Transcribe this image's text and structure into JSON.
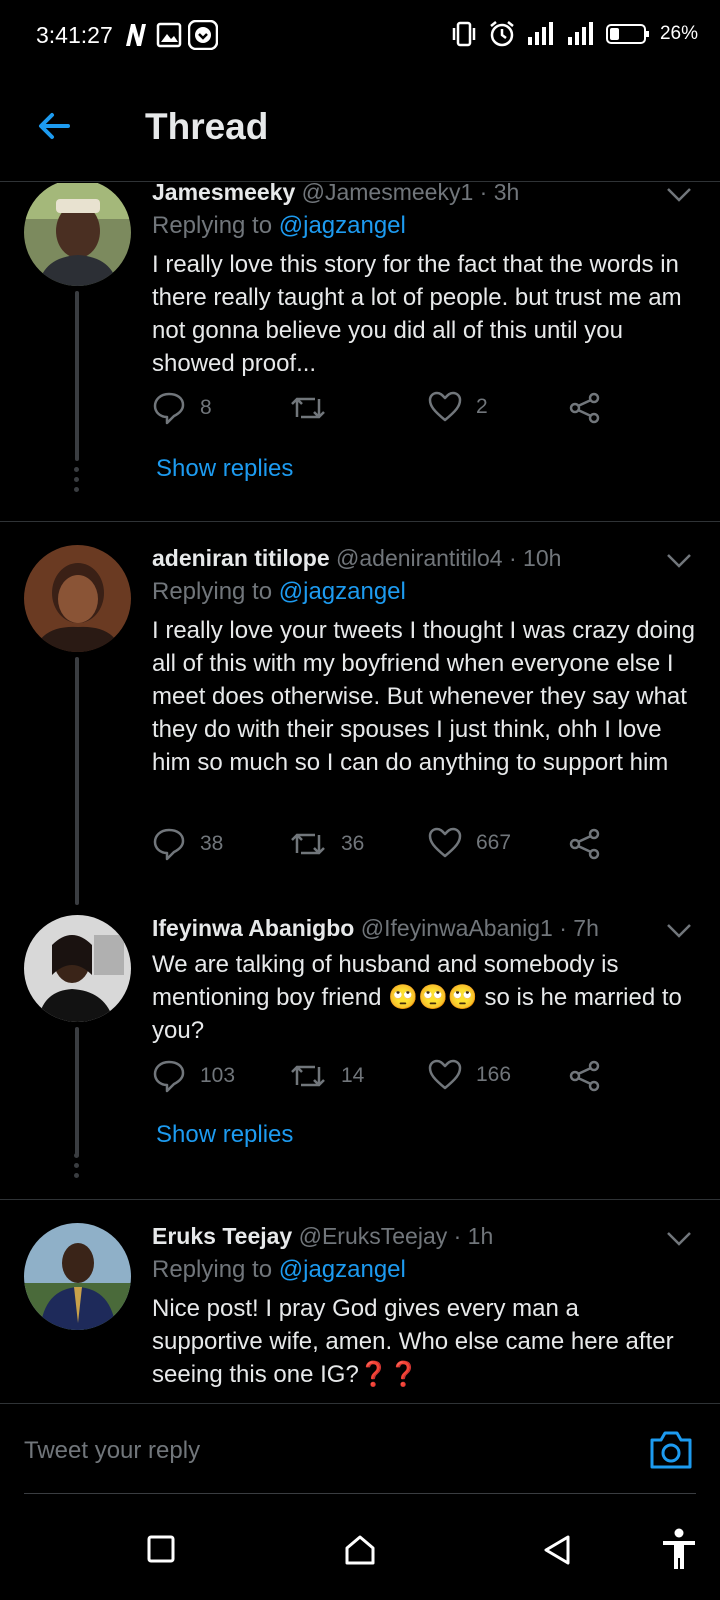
{
  "status_bar": {
    "time": "3:41:27",
    "battery": "26%",
    "icons": [
      "netflix-icon",
      "gallery-icon",
      "download-icon",
      "vibrate-icon",
      "alarm-icon",
      "signal-icon",
      "signal-icon",
      "battery-icon"
    ]
  },
  "header": {
    "title": "Thread",
    "back_icon": "arrow-left-icon"
  },
  "colors": {
    "accent": "#1d9bf0",
    "background": "#000000",
    "muted": "#71767b",
    "text": "#e7e9ea"
  },
  "tweets": [
    {
      "name": "Jamesmeeky",
      "handle": "@Jamesmeeky1",
      "time": "· 3h",
      "replying_label": "Replying to",
      "replying_to": "@jagzangel",
      "text": "I really love this story for the fact that the words in there really taught a lot of people. but trust me am not gonna believe you did all of this until you showed proof...",
      "replies": "8",
      "retweets": "",
      "likes": "2",
      "show_replies": "Show replies"
    },
    {
      "name": "adeniran titilope",
      "handle": "@adenirantitilo4",
      "time": "· 10h",
      "replying_label": "Replying to",
      "replying_to": "@jagzangel",
      "text": "I really love your tweets I thought I was crazy doing all of this with my boyfriend when everyone else I meet does otherwise. But whenever they say what they do with their spouses I just think, ohh I love him so much so I can do anything to support him",
      "replies": "38",
      "retweets": "36",
      "likes": "667"
    },
    {
      "name": "Ifeyinwa Abanigbo",
      "handle": "@IfeyinwaAbanig1",
      "time": "· 7h",
      "text_before": "We are talking of husband and somebody is mentioning boy friend ",
      "emoji": "🙄🙄🙄",
      "text_after": " so  is he married to you?",
      "replies": "103",
      "retweets": "14",
      "likes": "166",
      "show_replies": "Show replies"
    },
    {
      "name": "Eruks Teejay",
      "handle": "@EruksTeejay",
      "time": "· 1h",
      "replying_label": "Replying to",
      "replying_to": "@jagzangel",
      "text": "Nice post! I pray God gives every man a supportive wife, amen. Who else came here after seeing this one IG?❓❓"
    }
  ],
  "reply_bar": {
    "placeholder": "Tweet your reply",
    "camera_icon": "camera-icon"
  },
  "nav_bar": {
    "icons": [
      "square-icon",
      "home-icon",
      "back-triangle-icon",
      "accessibility-icon"
    ]
  }
}
